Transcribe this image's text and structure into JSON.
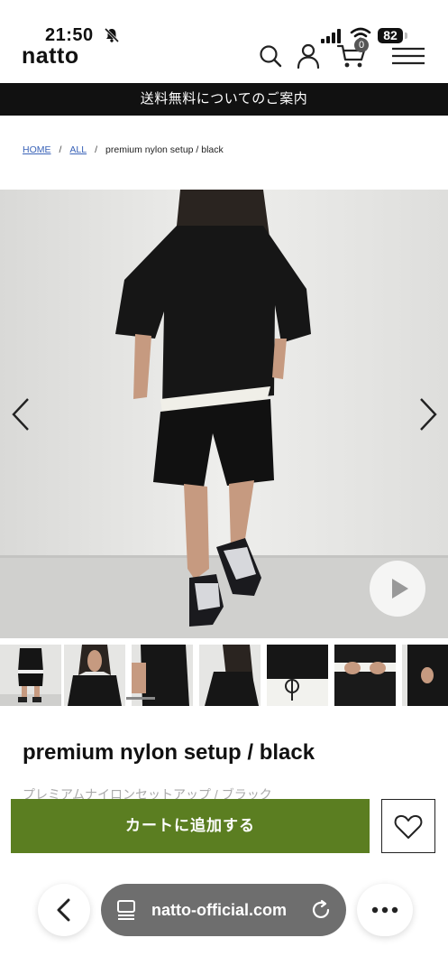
{
  "status_bar": {
    "time": "21:50",
    "battery": "82"
  },
  "header": {
    "logo": "natto",
    "cart_count": "0"
  },
  "announcement": "送料無料についてのご案内",
  "breadcrumb": {
    "home": "HOME",
    "all": "ALL",
    "sep": "/",
    "current": "premium nylon setup / black"
  },
  "product": {
    "title": "premium nylon setup / black",
    "subtitle": "プレミアムナイロンセットアップ / ブラック",
    "add_to_cart": "カートに追加する"
  },
  "browser": {
    "url": "natto-official.com"
  },
  "colors": {
    "accent": "#5b7e21",
    "announce_bg": "#111111",
    "link": "#3a63b8"
  },
  "icons": [
    "bell-icon",
    "signal-icon",
    "wifi-icon",
    "search-icon",
    "user-icon",
    "cart-icon",
    "menu-icon",
    "chevron-left-icon",
    "chevron-right-icon",
    "play-icon",
    "heart-icon",
    "tabs-icon",
    "reload-icon",
    "more-icon"
  ]
}
